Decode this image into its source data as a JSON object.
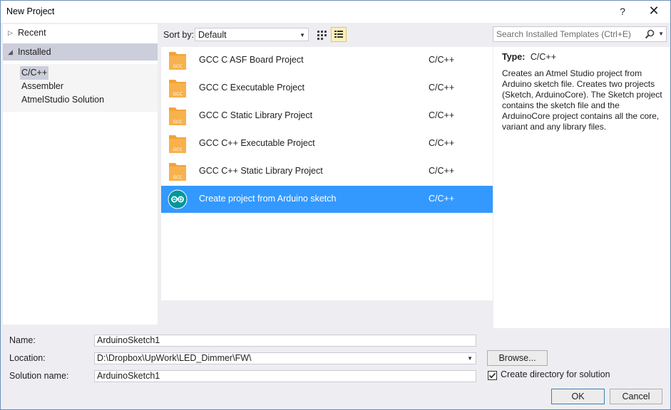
{
  "window": {
    "title": "New Project",
    "help_label": "?",
    "close_label": "✕"
  },
  "tree": {
    "recent": "Recent",
    "installed": "Installed",
    "items": [
      "C/C++",
      "Assembler",
      "AtmelStudio Solution"
    ]
  },
  "toolbar": {
    "sort_label": "Sort by:",
    "sort_value": "Default",
    "search_placeholder": "Search Installed Templates (Ctrl+E)"
  },
  "templates": [
    {
      "name": "GCC C ASF Board Project",
      "lang": "C/C++",
      "icon": "gcc-icon"
    },
    {
      "name": "GCC C Executable Project",
      "lang": "C/C++",
      "icon": "gcc-icon"
    },
    {
      "name": "GCC C Static Library Project",
      "lang": "C/C++",
      "icon": "gcc-icon"
    },
    {
      "name": "GCC C++ Executable Project",
      "lang": "C/C++",
      "icon": "gcc-icon"
    },
    {
      "name": "GCC C++ Static Library Project",
      "lang": "C/C++",
      "icon": "gcc-icon"
    },
    {
      "name": "Create project from Arduino sketch",
      "lang": "C/C++",
      "icon": "arduino-icon",
      "selected": true
    }
  ],
  "details": {
    "type_label": "Type:",
    "type_value": "C/C++",
    "description": "Creates an Atmel Studio project from Arduino sketch file. Creates two projects (Sketch, ArduinoCore). The Sketch project contains the sketch file and the ArduinoCore project contains all the core, variant and any library files."
  },
  "form": {
    "name_label": "Name:",
    "name_value": "ArduinoSketch1",
    "location_label": "Location:",
    "location_value": "D:\\Dropbox\\UpWork\\LED_Dimmer\\FW\\",
    "solution_label": "Solution name:",
    "solution_value": "ArduinoSketch1",
    "browse_label": "Browse...",
    "create_dir_label": "Create directory for solution",
    "create_dir_checked": true,
    "ok_label": "OK",
    "cancel_label": "Cancel"
  },
  "gcc_badge": "GCC",
  "colors": {
    "selection": "#3399ff",
    "gcc_orange": "#f5a623",
    "arduino_teal": "#00979c"
  }
}
